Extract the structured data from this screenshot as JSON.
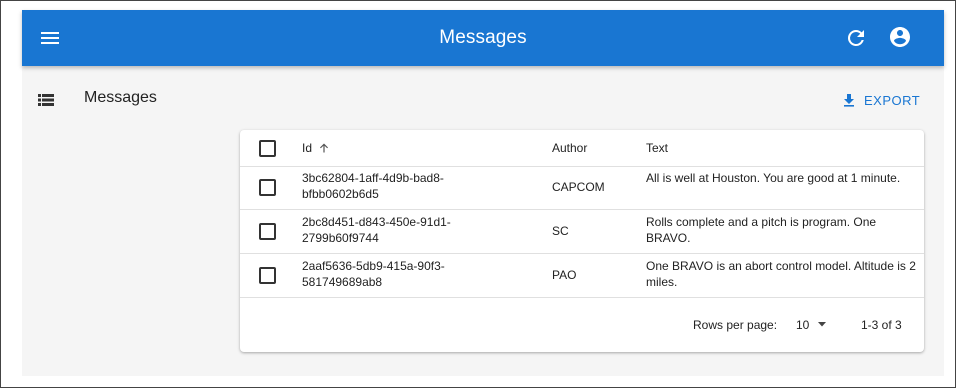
{
  "appbar": {
    "title": "Messages"
  },
  "list": {
    "heading": "Messages",
    "export_label": "EXPORT"
  },
  "table": {
    "columns": [
      "Id",
      "Author",
      "Text"
    ],
    "sort": {
      "column": "Id",
      "direction": "ascending"
    },
    "rows": [
      {
        "id": "3bc62804-1aff-4d9b-bad8-bfbb0602b6d5",
        "author": "CAPCOM",
        "text": "All is well at Houston. You are good at 1 minute.",
        "selected": false
      },
      {
        "id": "2bc8d451-d843-450e-91d1-2799b60f9744",
        "author": "SC",
        "text": "Rolls complete and a pitch is program. One BRAVO.",
        "selected": false
      },
      {
        "id": "2aaf5636-5db9-415a-90f3-581749689ab8",
        "author": "PAO",
        "text": "One BRAVO is an abort control model. Altitude is 2 miles.",
        "selected": false
      }
    ]
  },
  "pagination": {
    "rows_per_page_label": "Rows per page:",
    "rows_per_page": "10",
    "range": "1-3 of 3"
  },
  "colors": {
    "primary": "#1976d2",
    "background": "#f5f5f5"
  },
  "icons": [
    "menu-icon",
    "refresh-icon",
    "account-circle-icon",
    "list-icon",
    "download-icon",
    "arrow-up-icon",
    "caret-down-icon"
  ]
}
